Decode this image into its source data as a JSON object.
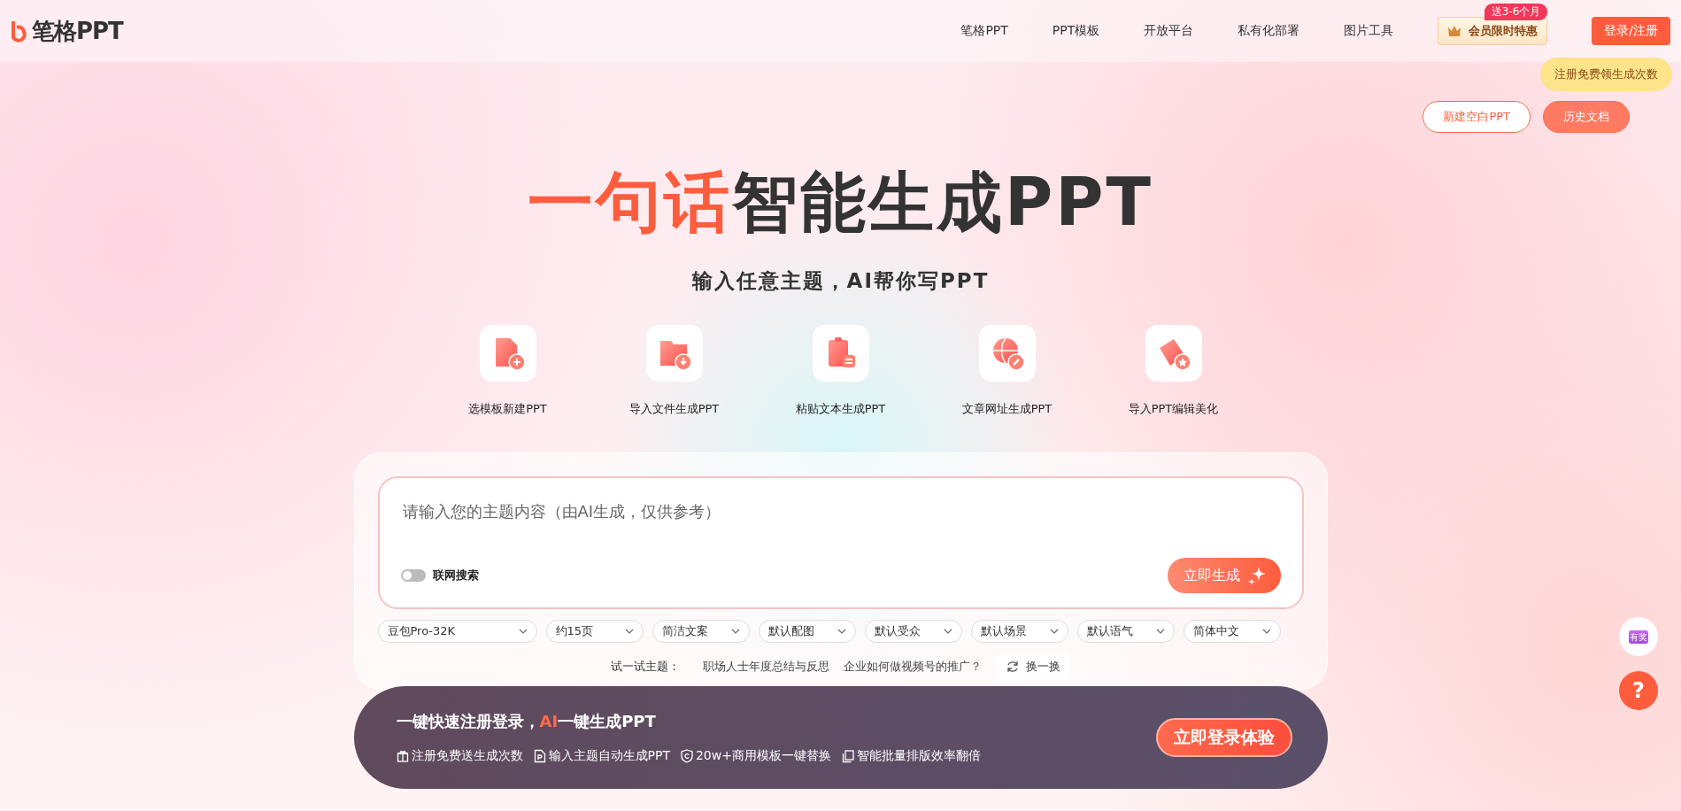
{
  "header": {
    "logo": "笔格PPT",
    "nav": [
      "笔格PPT",
      "PPT模板",
      "开放平台",
      "私有化部署",
      "图片工具"
    ],
    "vip": {
      "badge": "送3-6个月",
      "label": "会员限时特惠"
    },
    "login": "登录/注册",
    "tooltip": "注册免费领生成次数"
  },
  "actions": [
    "新建空白PPT",
    "历史文档"
  ],
  "hero": {
    "accent": "一句话",
    "title": "智能生成PPT",
    "subtitle": "输入任意主题，AI帮你写PPT"
  },
  "features": [
    {
      "kind": "template",
      "label": "选模板新建PPT"
    },
    {
      "kind": "file",
      "label": "导入文件生成PPT"
    },
    {
      "kind": "paste",
      "label": "粘贴文本生成PPT"
    },
    {
      "kind": "link",
      "label": "文章网址生成PPT"
    },
    {
      "kind": "beautify",
      "label": "导入PPT编辑美化"
    }
  ],
  "prompt": {
    "placeholder": "请输入您的主题内容（由AI生成，仅供参考）",
    "toggle": {
      "label": "联网搜索",
      "on": false
    },
    "generate": "立即生成"
  },
  "options": [
    "豆包Pro-32K",
    "约15页",
    "简洁文案",
    "默认配图",
    "默认受众",
    "默认场景",
    "默认语气",
    "简体中文"
  ],
  "try": {
    "label": "试一试主题：",
    "topics": [
      "职场人士年度总结与反思",
      "企业如何做视频号的推广？"
    ],
    "refresh": "换一换"
  },
  "banner": {
    "title": "一键快速注册登录，**AI**一键生成PPT",
    "perks": [
      {
        "kind": "gift",
        "label": "注册免费送生成次数"
      },
      {
        "kind": "doc",
        "label": "输入主题自动生成PPT"
      },
      {
        "kind": "shield",
        "label": "20w+商用模板一键替换"
      },
      {
        "kind": "copy",
        "label": "智能批量排版效率翻倍"
      }
    ],
    "cta": "立即登录体验"
  },
  "floating": {
    "prize": "有奖",
    "help": "?"
  }
}
